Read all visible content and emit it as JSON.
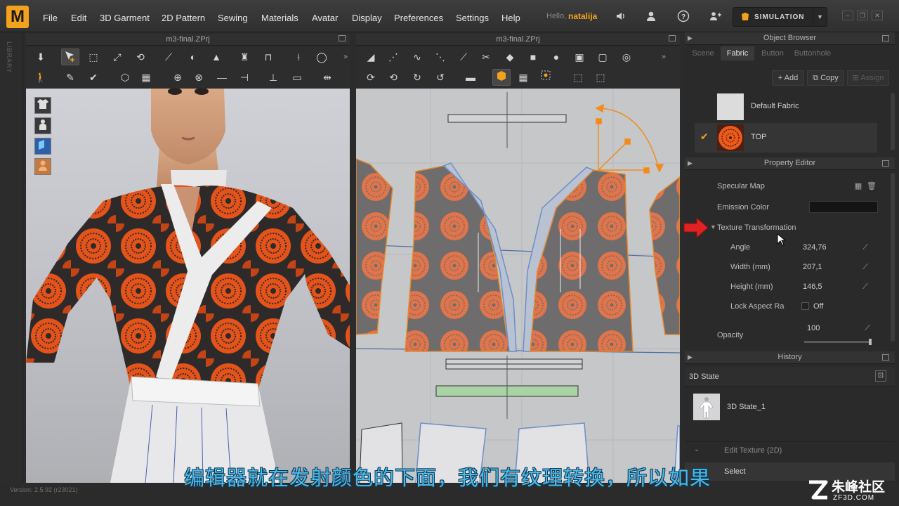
{
  "app": {
    "logo": "M",
    "menu": [
      "File",
      "Edit",
      "3D Garment",
      "2D Pattern",
      "Sewing",
      "Materials",
      "Avatar",
      "Display",
      "Preferences",
      "Settings",
      "Help"
    ],
    "hello": "Hello,",
    "user": "natalija",
    "simulation_label": "SIMULATION",
    "icons": [
      "speaker-icon",
      "user-icon",
      "help-icon",
      "share-icon"
    ]
  },
  "library_label": "LIBRARY",
  "viewport3d": {
    "title": "m3-final.ZPrj",
    "side_icons": [
      "garment-icon",
      "avatar-icon",
      "fabric-icon",
      "skin-icon"
    ]
  },
  "viewport2d": {
    "title": "m3-final.ZPrj"
  },
  "object_browser": {
    "title": "Object Browser",
    "tabs": [
      "Scene",
      "Fabric",
      "Button",
      "Buttonhole"
    ],
    "active_tab": "Fabric",
    "buttons": {
      "add": "Add",
      "copy": "Copy",
      "assign": "Assign"
    },
    "fabrics": [
      {
        "name": "Default Fabric",
        "selected": false
      },
      {
        "name": "TOP",
        "selected": true
      }
    ]
  },
  "property_editor": {
    "title": "Property Editor",
    "specular_map": "Specular Map",
    "emission_color": "Emission Color",
    "texture_transformation": "Texture Transformation",
    "angle_label": "Angle",
    "angle_value": "324,76",
    "width_label": "Width (mm)",
    "width_value": "207,1",
    "height_label": "Height (mm)",
    "height_value": "146,5",
    "lock_label": "Lock Aspect Ra",
    "lock_value": "Off",
    "opacity_label": "Opacity",
    "opacity_value": "100"
  },
  "history": {
    "title": "History",
    "state_header": "3D State",
    "state_item": "3D State_1",
    "edit_texture": "Edit Texture (2D)",
    "select": "Select"
  },
  "version": "Version: 2.5.92     (r23021)",
  "subtitle": "编辑器就在发射颜色的下面，我们有纹理转换，所以如果",
  "watermark": {
    "main": "朱峰社区",
    "sub": "ZF3D.COM"
  },
  "colors": {
    "accent": "#f2a21d",
    "print_orange": "#f0631a",
    "fabric_dark": "#2e2a2a"
  }
}
